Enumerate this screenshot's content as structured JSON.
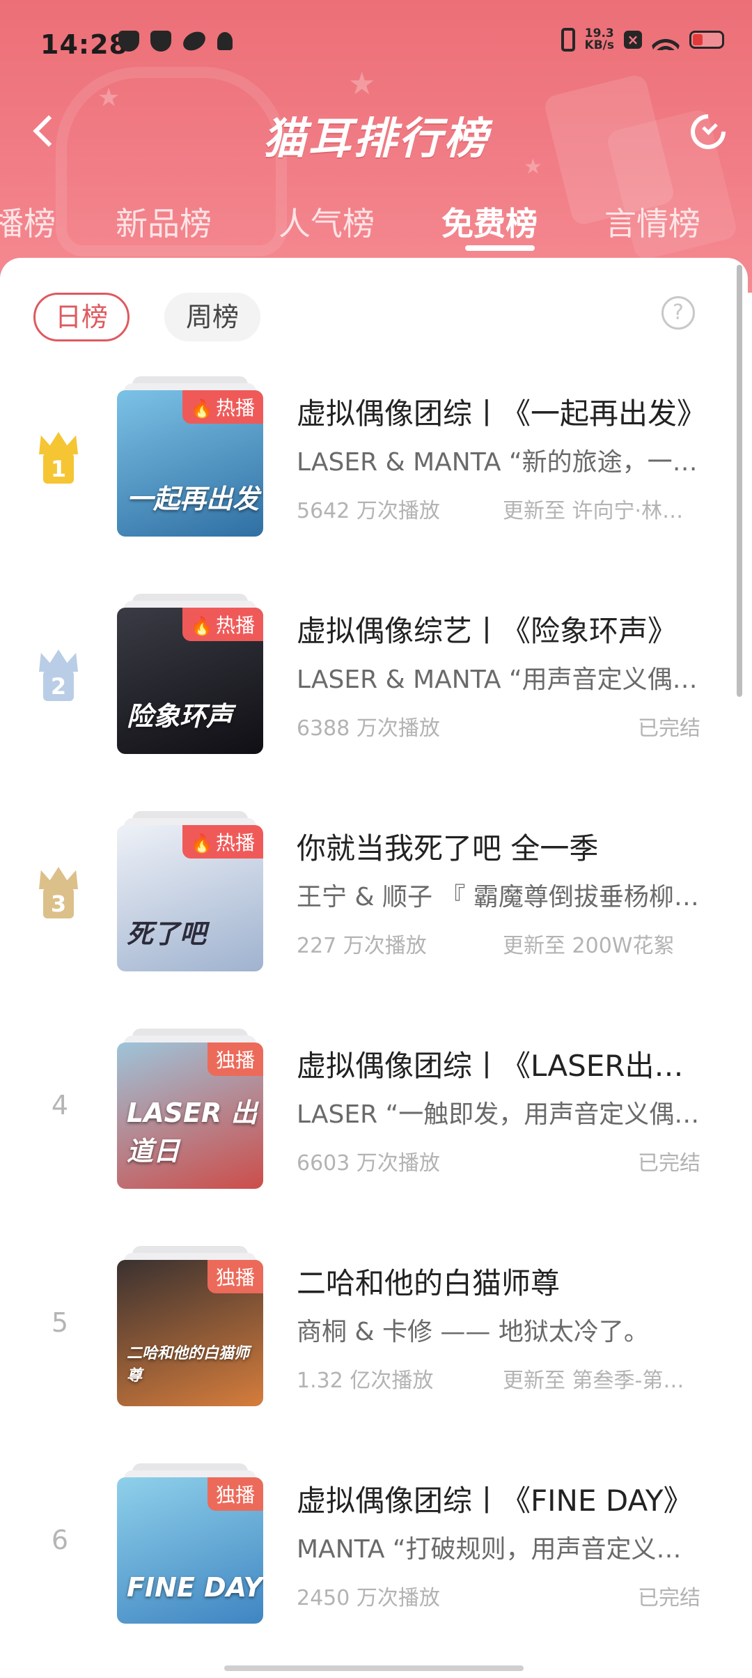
{
  "status_bar": {
    "time": "14:28",
    "net_speed_value": "19.3",
    "net_speed_unit": "KB/s",
    "x_badge": "×"
  },
  "header": {
    "title": "猫耳排行榜",
    "back_icon": "chevron-left-icon",
    "refresh_icon": "refresh-icon"
  },
  "tabs": [
    {
      "label": "播榜",
      "active": false
    },
    {
      "label": "新品榜",
      "active": false
    },
    {
      "label": "人气榜",
      "active": false
    },
    {
      "label": "免费榜",
      "active": true
    },
    {
      "label": "言情榜",
      "active": false
    }
  ],
  "period": {
    "daily": "日榜",
    "weekly": "周榜",
    "selected": "日榜",
    "help_icon": "?"
  },
  "items": [
    {
      "rank": "1",
      "title": "虚拟偶像团综丨《一起再出发》",
      "desc": "LASER & MANTA “新的旅途，一起再出发”",
      "plays": "5642 万次播放",
      "status": "更新至 许向宁·林逾期",
      "tag": "热播",
      "cover_text": "一起再出发",
      "cover_colors": [
        "#7cc2e6",
        "#2f6fa3"
      ]
    },
    {
      "rank": "2",
      "title": "虚拟偶像综艺丨《险象环声》",
      "desc": "LASER & MANTA “用声音定义偶像”",
      "plays": "6388 万次播放",
      "status": "已完结",
      "tag": "热播",
      "cover_text": "险象环声",
      "cover_colors": [
        "#3b3b45",
        "#0f0f14"
      ]
    },
    {
      "rank": "3",
      "title": "你就当我死了吧 全一季",
      "desc": "王宁 & 顺子 『 霸魔尊倒拔垂杨柳 』",
      "plays": "227 万次播放",
      "status": "更新至 200W花絮",
      "tag": "热播",
      "cover_text": "死了吧",
      "cover_colors": [
        "#eef1f7",
        "#9fb2cf"
      ]
    },
    {
      "rank": "4",
      "title": "虚拟偶像团综丨《LASER出道日》",
      "desc": "LASER “一触即发，用声音定义偶像”",
      "plays": "6603 万次播放",
      "status": "已完结",
      "tag": "独播",
      "cover_text": "LASER 出道日",
      "cover_colors": [
        "#9ec4da",
        "#cc4d4a"
      ]
    },
    {
      "rank": "5",
      "title": "二哈和他的白猫师尊",
      "desc": "商桐 & 卡修 —— 地狱太冷了。",
      "plays": "1.32 亿次播放",
      "status": "更新至 第叁季-第一集",
      "tag": "独播",
      "cover_text": "二哈和他的白猫师尊",
      "cover_colors": [
        "#3a3130",
        "#d67d3c"
      ]
    },
    {
      "rank": "6",
      "title": "虚拟偶像团综丨《FINE DAY》",
      "desc": "MANTA “打破规则，用声音定义偶像”",
      "plays": "2450 万次播放",
      "status": "已完结",
      "tag": "独播",
      "cover_text": "FINE DAY",
      "cover_colors": [
        "#8fd0ea",
        "#3f85c2"
      ]
    }
  ],
  "colors": {
    "accent": "#de5a5f",
    "header_top": "#ec6f77",
    "crown_gold": "#f5c533",
    "crown_silver": "#b9cde6",
    "crown_bronze": "#dcc08a"
  }
}
